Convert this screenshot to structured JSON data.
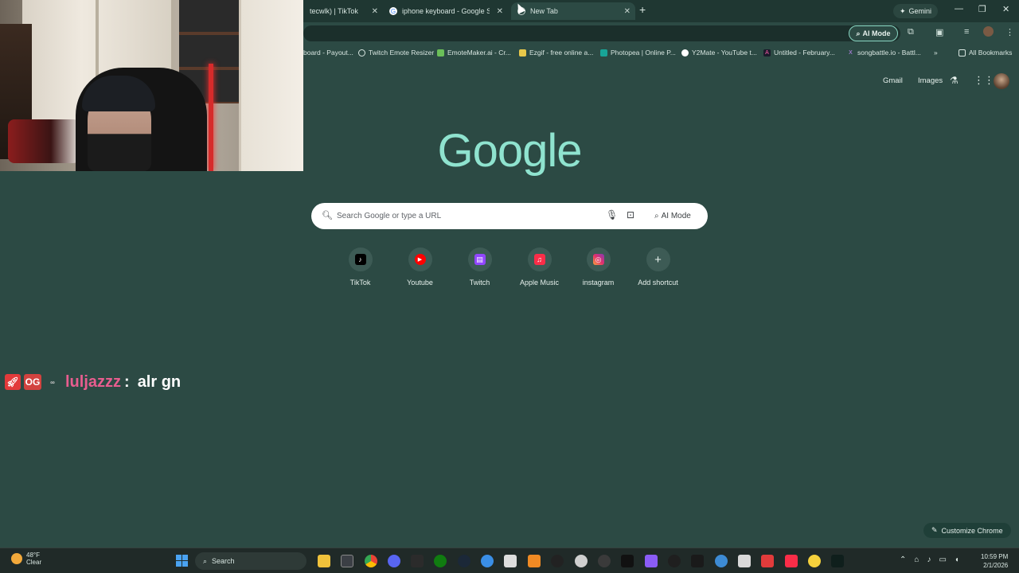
{
  "browser": {
    "tabs": [
      {
        "label": "tecwlk) | TikTok",
        "favicon": "tiktok-icon"
      },
      {
        "label": "iphone keyboard - Google Sea",
        "favicon": "google-icon"
      },
      {
        "label": "New Tab",
        "favicon": "chrome-icon"
      }
    ],
    "gemini_label": "Gemini",
    "omnibox_ai_mode": "AI Mode",
    "bookmarks": [
      {
        "label": "board - Payout...",
        "icon": "bookmark-icon"
      },
      {
        "label": "Twitch Emote Resizer",
        "icon": "globe-icon"
      },
      {
        "label": "EmoteMaker.ai - Cr...",
        "icon": "emotemaker-icon"
      },
      {
        "label": "Ezgif - free online a...",
        "icon": "ezgif-icon"
      },
      {
        "label": "Photopea | Online P...",
        "icon": "photopea-icon"
      },
      {
        "label": "Y2Mate - YouTube t...",
        "icon": "y2mate-icon"
      },
      {
        "label": "Untitled - February...",
        "icon": "adobe-icon"
      },
      {
        "label": "songbattle.io - Battl...",
        "icon": "songbattle-icon"
      }
    ],
    "all_bookmarks": "All Bookmarks",
    "more_bookmarks": "»"
  },
  "newtab": {
    "gmail": "Gmail",
    "images": "Images",
    "logo": "Google",
    "search_placeholder": "Search Google or type a URL",
    "ai_mode": "AI Mode",
    "shortcuts": [
      {
        "label": "TikTok",
        "icon": "tiktok-icon",
        "color": "#000000",
        "glyph": "♪"
      },
      {
        "label": "Youtube",
        "icon": "youtube-icon",
        "color": "#ff0000",
        "glyph": "▶"
      },
      {
        "label": "Twitch",
        "icon": "twitch-icon",
        "color": "#9146ff",
        "glyph": "▤"
      },
      {
        "label": "Apple Music",
        "icon": "apple-music-icon",
        "color": "#fa2d48",
        "glyph": "♫"
      },
      {
        "label": "instagram",
        "icon": "instagram-icon",
        "color": "#e1306c",
        "glyph": "◎"
      },
      {
        "label": "Add shortcut",
        "icon": "plus-icon",
        "color": "#3d5b55",
        "glyph": "+"
      }
    ],
    "customize": "Customize Chrome"
  },
  "chat": {
    "badge_og": "OG",
    "username": "luljazzz",
    "colon": ":",
    "message": "alr gn"
  },
  "taskbar": {
    "temperature": "48°F",
    "weather": "Clear",
    "search_label": "Search",
    "time": "10:59 PM",
    "date": "2/1/2026"
  }
}
